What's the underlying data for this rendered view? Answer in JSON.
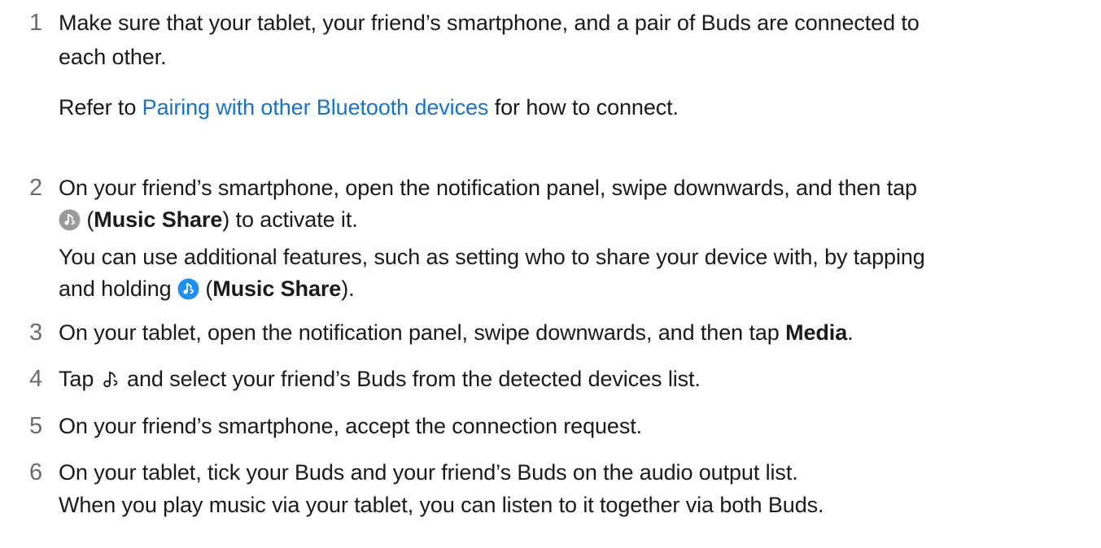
{
  "steps": [
    {
      "num": "1",
      "text_a": "Make sure that your tablet, your friend’s smartphone, and a pair of Buds are connected to",
      "text_b": "each other.",
      "ref_prefix": "Refer to ",
      "ref_link": "Pairing with other Bluetooth devices",
      "ref_suffix": " for how to connect."
    },
    {
      "num": "2",
      "text_a": "On your friend’s smartphone, open the notification panel, swipe downwards, and then tap",
      "paren_open": " (",
      "bold": "Music Share",
      "text_b_suffix": ") to activate it.",
      "note_a": "You can use additional features, such as setting who to share your device with, by tapping",
      "note_b_prefix": "and holding ",
      "note_bold": "Music Share",
      "note_b_suffix": ")."
    },
    {
      "num": "3",
      "text": "On your tablet, open the notification panel, swipe downwards, and then tap ",
      "bold": "Media",
      "suffix": "."
    },
    {
      "num": "4",
      "prefix": "Tap ",
      "suffix": " and select your friend’s Buds from the detected devices list."
    },
    {
      "num": "5",
      "text": "On your friend’s smartphone, accept the connection request."
    },
    {
      "num": "6",
      "text_a": "On your tablet, tick your Buds and your friend’s Buds on the audio output list.",
      "text_b": "When you play music via your tablet, you can listen to it together via both Buds."
    }
  ],
  "icons": {
    "music_share_off": "music-share-icon-grey",
    "music_share_on": "music-share-icon-blue",
    "music_note": "music-note-icon"
  },
  "colors": {
    "link": "#1a72c4",
    "number": "#6b6b6b",
    "text": "#1a1a1a",
    "icon_grey": "#9a9a9a",
    "icon_blue": "#1d8ff2"
  }
}
